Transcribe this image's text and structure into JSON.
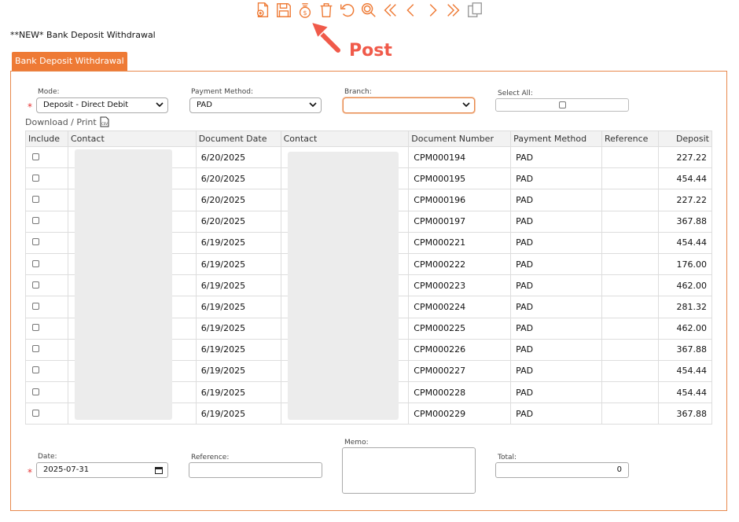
{
  "toolbar": {
    "icons": [
      "new-document-icon",
      "save-icon",
      "post-money-icon",
      "delete-icon",
      "undo-icon",
      "search-icon",
      "first-record-icon",
      "previous-record-icon",
      "next-record-icon",
      "last-record-icon",
      "copy-icon"
    ]
  },
  "page": {
    "heading": "**NEW* Bank Deposit Withdrawal",
    "tab_label": "Bank Deposit Withdrawal"
  },
  "annotation": {
    "label": "Post",
    "color": "#f05a4a"
  },
  "filters": {
    "mode_label": "Mode:",
    "mode_value": "Deposit - Direct Debit",
    "payment_method_label": "Payment Method:",
    "payment_method_value": "PAD",
    "branch_label": "Branch:",
    "branch_value": "",
    "select_all_label": "Select All:"
  },
  "download_label": "Download / Print",
  "table": {
    "headers": [
      "Include",
      "Contact",
      "Document Date",
      "Contact",
      "Document Number",
      "Payment Method",
      "Reference",
      "Deposit"
    ],
    "rows": [
      {
        "date": "6/20/2025",
        "doc": "CPM000194",
        "method": "PAD",
        "reference": "",
        "deposit": "227.22"
      },
      {
        "date": "6/20/2025",
        "doc": "CPM000195",
        "method": "PAD",
        "reference": "",
        "deposit": "454.44"
      },
      {
        "date": "6/20/2025",
        "doc": "CPM000196",
        "method": "PAD",
        "reference": "",
        "deposit": "227.22"
      },
      {
        "date": "6/20/2025",
        "doc": "CPM000197",
        "method": "PAD",
        "reference": "",
        "deposit": "367.88"
      },
      {
        "date": "6/19/2025",
        "doc": "CPM000221",
        "method": "PAD",
        "reference": "",
        "deposit": "454.44"
      },
      {
        "date": "6/19/2025",
        "doc": "CPM000222",
        "method": "PAD",
        "reference": "",
        "deposit": "176.00"
      },
      {
        "date": "6/19/2025",
        "doc": "CPM000223",
        "method": "PAD",
        "reference": "",
        "deposit": "462.00"
      },
      {
        "date": "6/19/2025",
        "doc": "CPM000224",
        "method": "PAD",
        "reference": "",
        "deposit": "281.32"
      },
      {
        "date": "6/19/2025",
        "doc": "CPM000225",
        "method": "PAD",
        "reference": "",
        "deposit": "462.00"
      },
      {
        "date": "6/19/2025",
        "doc": "CPM000226",
        "method": "PAD",
        "reference": "",
        "deposit": "367.88"
      },
      {
        "date": "6/19/2025",
        "doc": "CPM000227",
        "method": "PAD",
        "reference": "",
        "deposit": "454.44"
      },
      {
        "date": "6/19/2025",
        "doc": "CPM000228",
        "method": "PAD",
        "reference": "",
        "deposit": "454.44"
      },
      {
        "date": "6/19/2025",
        "doc": "CPM000229",
        "method": "PAD",
        "reference": "",
        "deposit": "367.88"
      }
    ]
  },
  "footer": {
    "date_label": "Date:",
    "date_value": "2025-07-31",
    "reference_label": "Reference:",
    "reference_value": "",
    "memo_label": "Memo:",
    "memo_value": "",
    "total_label": "Total:",
    "total_value": "0"
  },
  "colors": {
    "accent": "#ee7a35",
    "border": "#e8884c",
    "required": "#e53030"
  }
}
